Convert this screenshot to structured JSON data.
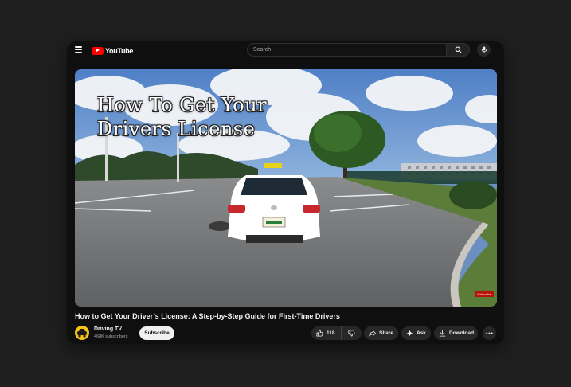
{
  "header": {
    "logo_text": "YouTube",
    "search_placeholder": "Search"
  },
  "video": {
    "overlay_line1": "How To Get Your",
    "overlay_line2": "Drivers License",
    "subscribe_watermark": "Subscribe"
  },
  "details": {
    "title": "How to Get Your Driver’s License: A Step-by-Step Guide for First-Time Drivers",
    "channel_name": "Driving TV",
    "subscriber_count": "468K subscribers",
    "subscribe_label": "Subscribe",
    "like_count": "118",
    "share_label": "Share",
    "ask_label": "Ask",
    "download_label": "Download"
  },
  "colors": {
    "brand_red": "#ff0000",
    "background": "#0f0f0f",
    "pill": "#272727"
  }
}
